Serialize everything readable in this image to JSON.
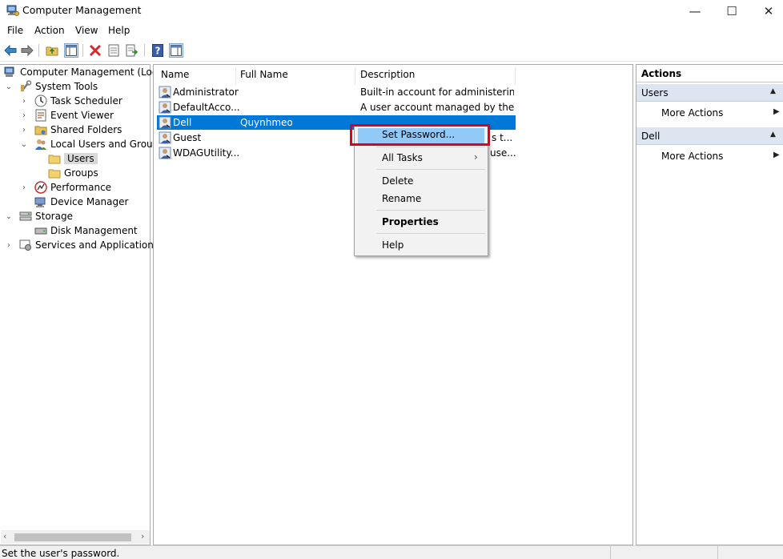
{
  "window": {
    "title": "Computer Management"
  },
  "menu": [
    "File",
    "Action",
    "View",
    "Help"
  ],
  "tree": {
    "root": "Computer Management (Local",
    "system_tools": "System Tools",
    "task_scheduler": "Task Scheduler",
    "event_viewer": "Event Viewer",
    "shared_folders": "Shared Folders",
    "local_users_groups": "Local Users and Groups",
    "users": "Users",
    "groups": "Groups",
    "performance": "Performance",
    "device_manager": "Device Manager",
    "storage": "Storage",
    "disk_management": "Disk Management",
    "services_apps": "Services and Applications"
  },
  "list": {
    "columns": [
      "Name",
      "Full Name",
      "Description"
    ],
    "rows": [
      {
        "name": "Administrator",
        "full_name": "",
        "description": "Built-in account for administering..."
      },
      {
        "name": "DefaultAcco...",
        "full_name": "",
        "description": "A user account managed by the s..."
      },
      {
        "name": "Dell",
        "full_name": "Quynhmeo",
        "description": ""
      },
      {
        "name": "Guest",
        "full_name": "",
        "description": "s t..."
      },
      {
        "name": "WDAGUtility...",
        "full_name": "",
        "description": "use..."
      }
    ]
  },
  "context_menu": {
    "set_password": "Set Password...",
    "all_tasks": "All Tasks",
    "delete": "Delete",
    "rename": "Rename",
    "properties": "Properties",
    "help": "Help"
  },
  "actions": {
    "header": "Actions",
    "section1": "Users",
    "more1": "More Actions",
    "section2": "Dell",
    "more2": "More Actions"
  },
  "status": "Set the user's password.",
  "colors": {
    "selection": "#0078d7",
    "highlight": "#91c9f7",
    "callout": "#e0001b",
    "section_bar": "#dce5f0"
  }
}
